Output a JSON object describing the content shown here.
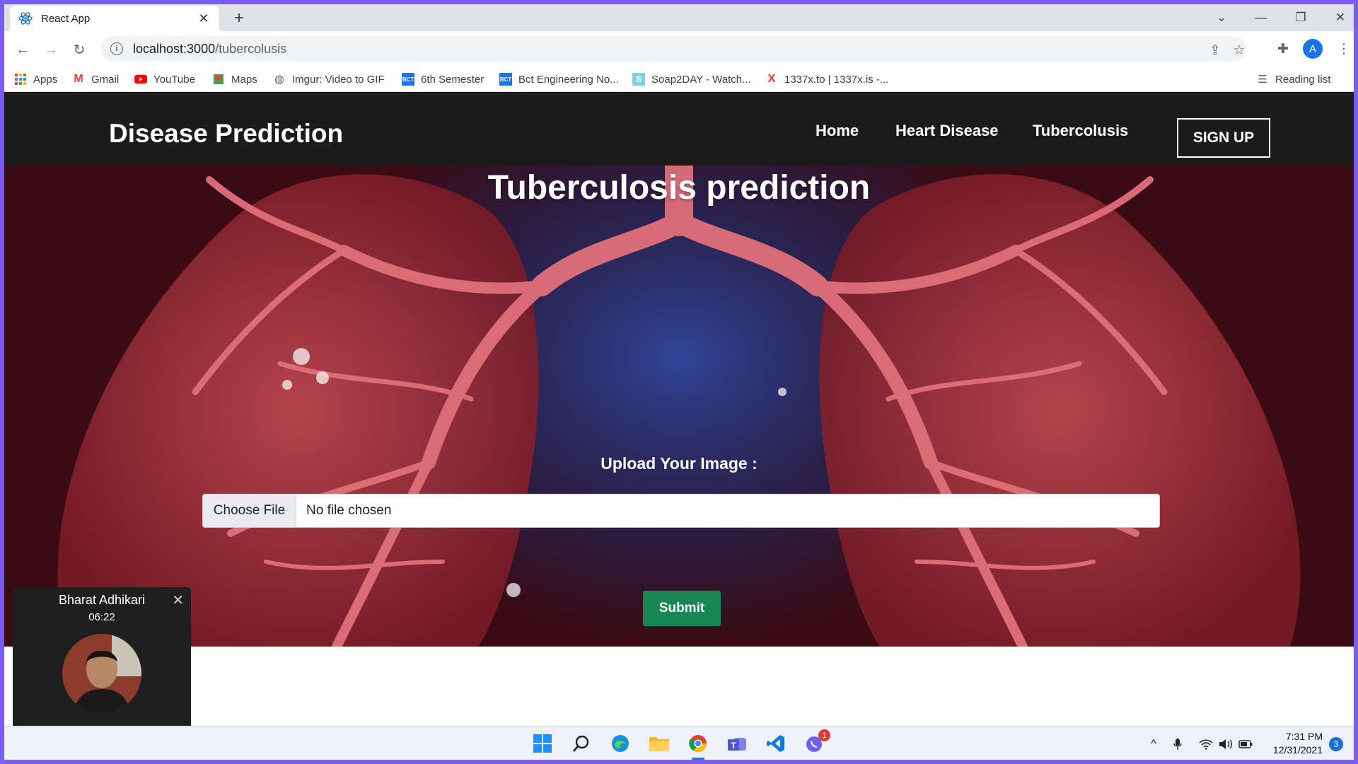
{
  "browser": {
    "tab_title": "React App",
    "url_host": "localhost:3000",
    "url_path": "/tubercolusis",
    "avatar_letter": "A",
    "bookmarks": [
      "Apps",
      "Gmail",
      "YouTube",
      "Maps",
      "Imgur: Video to GIF",
      "6th Semester",
      "Bct Engineering No...",
      "Soap2DAY - Watch...",
      "1337x.to | 1337x.is -..."
    ],
    "reading_list": "Reading list"
  },
  "site": {
    "brand": "Disease Prediction",
    "nav": [
      "Home",
      "Heart Disease",
      "Tubercolusis"
    ],
    "signup": "SIGN UP",
    "hero_title": "Tuberculosis prediction",
    "upload_label": "Upload Your Image :",
    "choose_file": "Choose File",
    "no_file": "No file chosen",
    "submit": "Submit"
  },
  "call": {
    "name": "Bharat Adhikari",
    "duration": "06:22"
  },
  "taskbar": {
    "time": "7:31 PM",
    "date": "12/31/2021",
    "notification_count": "3",
    "viber_badge": "1"
  },
  "colors": {
    "navbar": "#1c1c1c",
    "submit": "#198754",
    "frame": "#7b5cf0"
  }
}
